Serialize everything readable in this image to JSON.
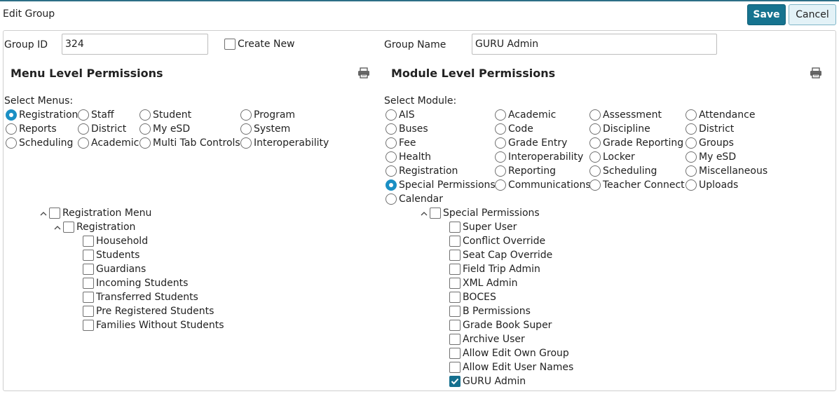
{
  "header": {
    "title": "Edit Group",
    "save_label": "Save",
    "cancel_label": "Cancel"
  },
  "form": {
    "group_id_label": "Group ID",
    "group_id_value": "324",
    "create_new_label": "Create New",
    "group_name_label": "Group Name",
    "group_name_value": "GURU Admin"
  },
  "menu_permissions": {
    "title": "Menu Level Permissions",
    "select_label": "Select Menus:",
    "options": [
      "Registration",
      "Staff",
      "Student",
      "Program",
      "Reports",
      "District",
      "My eSD",
      "System",
      "Scheduling",
      "Academic",
      "Multi Tab Controls",
      "Interoperability"
    ],
    "selected": "Registration",
    "tree_root": "Registration Menu",
    "tree_group": "Registration",
    "tree_items": [
      "Household",
      "Students",
      "Guardians",
      "Incoming Students",
      "Transferred Students",
      "Pre Registered Students",
      "Families Without Students"
    ]
  },
  "module_permissions": {
    "title": "Module Level Permissions",
    "select_label": "Select Module:",
    "options": [
      "AIS",
      "Academic",
      "Assessment",
      "Attendance",
      "Buses",
      "Code",
      "Discipline",
      "District",
      "Fee",
      "Grade Entry",
      "Grade Reporting",
      "Groups",
      "Health",
      "Interoperability",
      "Locker",
      "My eSD",
      "Registration",
      "Reporting",
      "Scheduling",
      "Miscellaneous",
      "Special Permissions",
      "Communications",
      "Teacher Connect",
      "Uploads",
      "Calendar"
    ],
    "selected": "Special Permissions",
    "tree_root": "Special Permissions",
    "tree_items": [
      "Super User",
      "Conflict Override",
      "Seat Cap Override",
      "Field Trip Admin",
      "XML Admin",
      "BOCES",
      "B Permissions",
      "Grade Book Super",
      "Archive User",
      "Allow Edit Own Group",
      "Allow Edit User Names",
      "GURU Admin"
    ],
    "checked": [
      "GURU Admin"
    ]
  },
  "icons": {
    "print": "printer-icon",
    "collapse": "chevron-up-icon",
    "check": "checkmark-icon"
  },
  "colors": {
    "accent": "#16738f",
    "radio_selected": "#1a8fc4",
    "cancel_bg": "#e3f2f7"
  }
}
